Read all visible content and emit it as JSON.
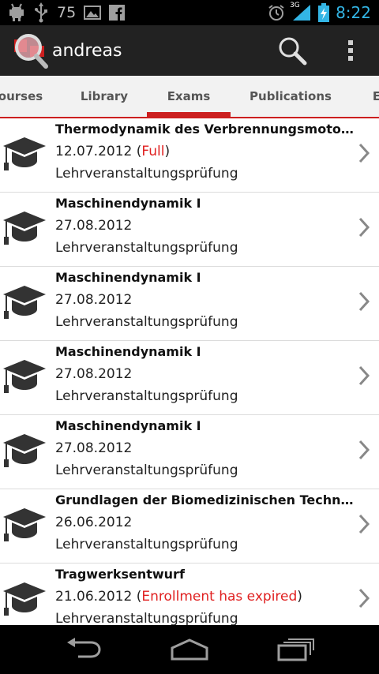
{
  "status_bar": {
    "notification_icons": [
      "android-debug-icon",
      "usb-icon",
      "picture-icon",
      "facebook-icon"
    ],
    "battery_number": "75",
    "network_type": "3G",
    "time": "8:22",
    "colors": {
      "time": "#33b5e5",
      "icons": "#bdbdbd"
    }
  },
  "action_bar": {
    "title": "andreas",
    "icons": [
      "app-logo-icon",
      "search-icon",
      "overflow-menu-icon"
    ]
  },
  "tabs": [
    {
      "label": "ourses",
      "selected": false
    },
    {
      "label": "Library",
      "selected": false
    },
    {
      "label": "Exams",
      "selected": true
    },
    {
      "label": "Publications",
      "selected": false
    },
    {
      "label": "E",
      "selected": false
    }
  ],
  "exams": [
    {
      "title": "Thermodynamik des Verbrennungsmotors",
      "date": "12.07.2012",
      "status": "Full",
      "type": "Lehrveranstaltungsprüfung"
    },
    {
      "title": "Maschinendynamik I",
      "date": "27.08.2012",
      "status": "",
      "type": "Lehrveranstaltungsprüfung"
    },
    {
      "title": "Maschinendynamik I",
      "date": "27.08.2012",
      "status": "",
      "type": "Lehrveranstaltungsprüfung"
    },
    {
      "title": "Maschinendynamik I",
      "date": "27.08.2012",
      "status": "",
      "type": "Lehrveranstaltungsprüfung"
    },
    {
      "title": "Maschinendynamik I",
      "date": "27.08.2012",
      "status": "",
      "type": "Lehrveranstaltungsprüfung"
    },
    {
      "title": "Grundlagen der Biomedizinischen Technik, …",
      "date": "26.06.2012",
      "status": "",
      "type": "Lehrveranstaltungsprüfung"
    },
    {
      "title": "Tragwerksentwurf",
      "date": "21.06.2012",
      "status": "Enrollment has expired",
      "type": "Lehrveranstaltungsprüfung"
    }
  ],
  "nav_bar": {
    "buttons": [
      "back-icon",
      "home-icon",
      "recent-apps-icon"
    ]
  },
  "colors": {
    "accent": "#cc1f1f",
    "status_text": "#e02020",
    "action_bar": "#222222",
    "tab_bar": "#f2f2f2"
  }
}
